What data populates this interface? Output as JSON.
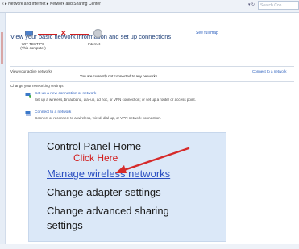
{
  "address_bar": {
    "breadcrumb": "« ▸ Network and Internet ▸ Network and Sharing Center",
    "refresh_icon": "refresh-icon",
    "search_placeholder": "Search Con"
  },
  "main": {
    "heading": "View your basic network information and set up connections",
    "see_full_map": "See full map",
    "computer_name": "WIT-TEST-PC",
    "computer_sub": "(This computer)",
    "internet_label": "Internet",
    "active_networks_label": "View your active networks",
    "not_connected_text": "You are currently not connected to any networks.",
    "connect_to_network": "Connect to a network",
    "change_settings_label": "Change your networking settings",
    "tasks": [
      {
        "link": "Set up a new connection or network",
        "desc": "Set up a wireless, broadband, dial-up, ad hoc, or VPN connection; or set up a router or access point."
      },
      {
        "link": "Connect to a network",
        "desc": "Connect or reconnect to a wireless, wired, dial-up, or VPN network connection."
      }
    ]
  },
  "zoom_panel": {
    "control_panel_home": "Control Panel Home",
    "manage_wireless": "Manage wireless networks",
    "change_adapter": "Change adapter settings",
    "change_advanced_1": "Change advanced sharing",
    "change_advanced_2": "settings"
  },
  "annotation": {
    "click_here": "Click Here",
    "arrow_color": "#d62a2a"
  }
}
